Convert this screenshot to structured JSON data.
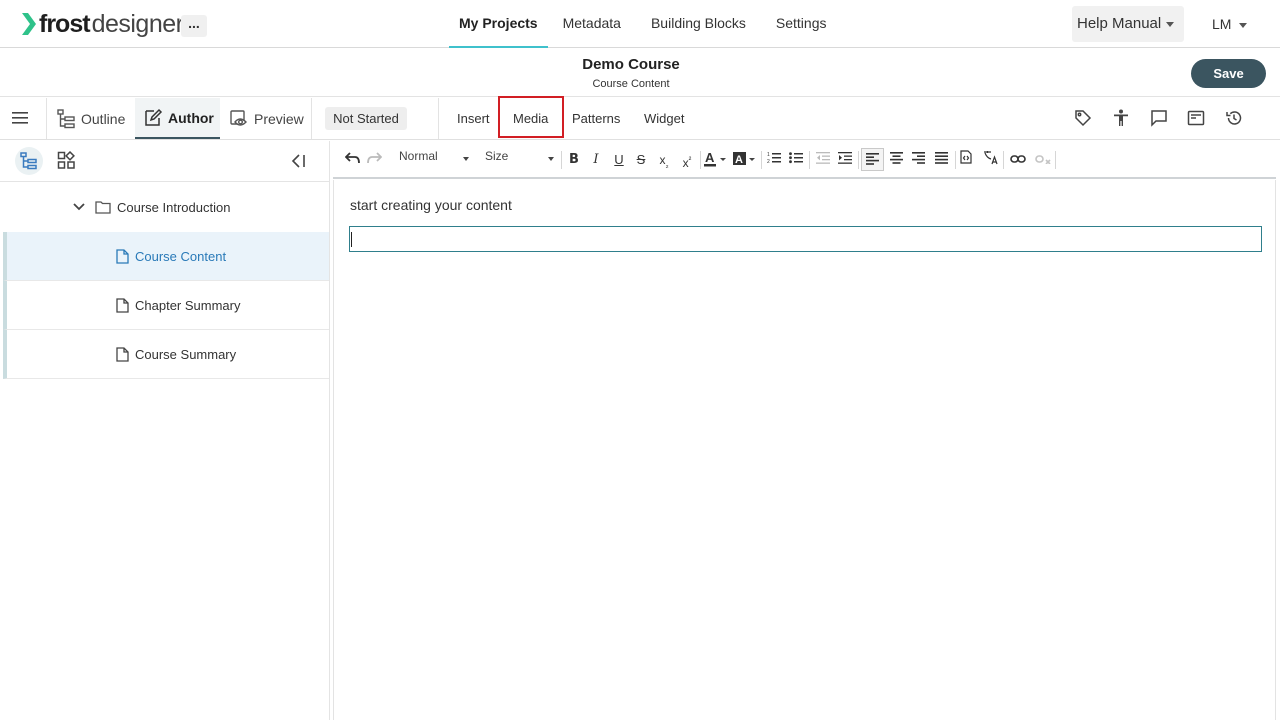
{
  "app": {
    "brand_bold": "frost",
    "brand_light": "designer",
    "more_label": "...",
    "accent_color": "#3fc1cc",
    "dark_color": "#3b5560"
  },
  "nav": {
    "items": [
      {
        "label": "My Projects",
        "active": true
      },
      {
        "label": "Metadata"
      },
      {
        "label": "Building Blocks"
      },
      {
        "label": "Settings"
      }
    ],
    "help_label": "Help Manual",
    "user_initials": "LM"
  },
  "header": {
    "title": "Demo Course",
    "subtitle": "Course Content",
    "save_label": "Save"
  },
  "modes": {
    "outline_label": "Outline",
    "author_label": "Author",
    "preview_label": "Preview",
    "status_label": "Not Started",
    "insert_tabs": [
      "Insert",
      "Media",
      "Patterns",
      "Widget"
    ],
    "right_icons": [
      "tag-icon",
      "accessibility-icon",
      "comment-icon",
      "panel-icon",
      "history-icon"
    ]
  },
  "sidebar": {
    "folder": {
      "label": "Course Introduction"
    },
    "pages": [
      {
        "label": "Course Content",
        "selected": true
      },
      {
        "label": "Chapter Summary"
      },
      {
        "label": "Course Summary"
      }
    ]
  },
  "toolbar": {
    "format_value": "Normal",
    "size_value": "Size"
  },
  "editor": {
    "content_text": "start creating your content"
  }
}
